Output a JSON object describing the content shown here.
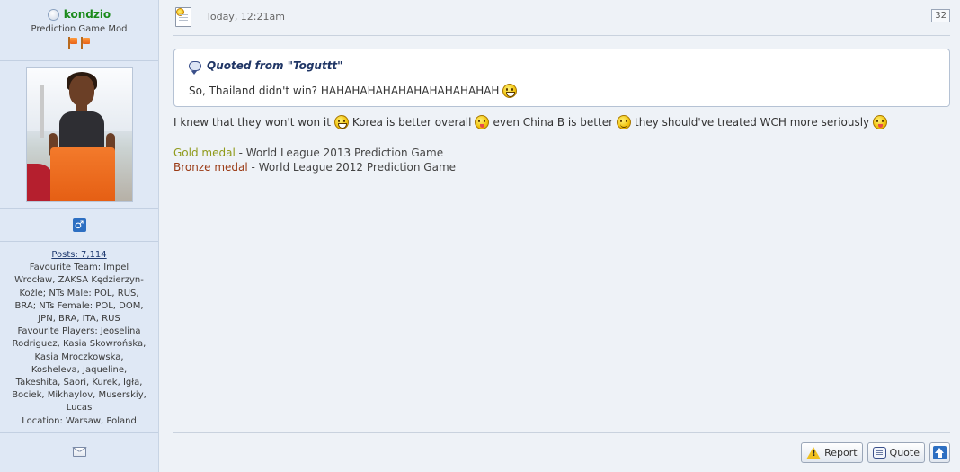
{
  "user": {
    "username": "kondzio",
    "title": "Prediction Game Mod",
    "gender_symbol": "♂",
    "posts": "Posts: 7,114",
    "info_lines": [
      "Favourite Team: Impel",
      "Wrocław, ZAKSA Kędzierzyn-",
      "Koźle; NTs Male: POL, RUS,",
      "BRA; NTs Female: POL, DOM,",
      "JPN, BRA, ITA, RUS",
      "Favourite Players: Jeoselina",
      "Rodriguez, Kasia Skowrońska,",
      "Kasia Mroczkowska,",
      "Kosheleva, Jaqueline,",
      "Takeshita, Saori, Kurek, Igła,",
      "Bociek, Mikhaylov, Muserskiy,",
      "Lucas",
      "Location: Warsaw, Poland"
    ]
  },
  "post": {
    "date": "Today, 12:21am",
    "number": "32",
    "quote": {
      "label": "Quoted from \"Toguttt\"",
      "text": "So, Thailand didn't win? HAHAHAHAHAHAHAHAHAHAHAH"
    },
    "body": {
      "part1": "I knew that they won't won it",
      "part2": "Korea is better overall",
      "part3": "even China B is better",
      "part4": "they should've treated WCH more seriously"
    },
    "signature": {
      "gold_label": "Gold medal",
      "gold_rest": " - World League 2013 Prediction Game",
      "bronze_label": "Bronze medal",
      "bronze_rest": " - World League 2012 Prediction Game"
    }
  },
  "footer": {
    "report_label": "Report",
    "quote_label": "Quote"
  },
  "colors": {
    "username": "#1a8a1a",
    "gold": "#8f9a1a",
    "bronze": "#9a3a14"
  }
}
